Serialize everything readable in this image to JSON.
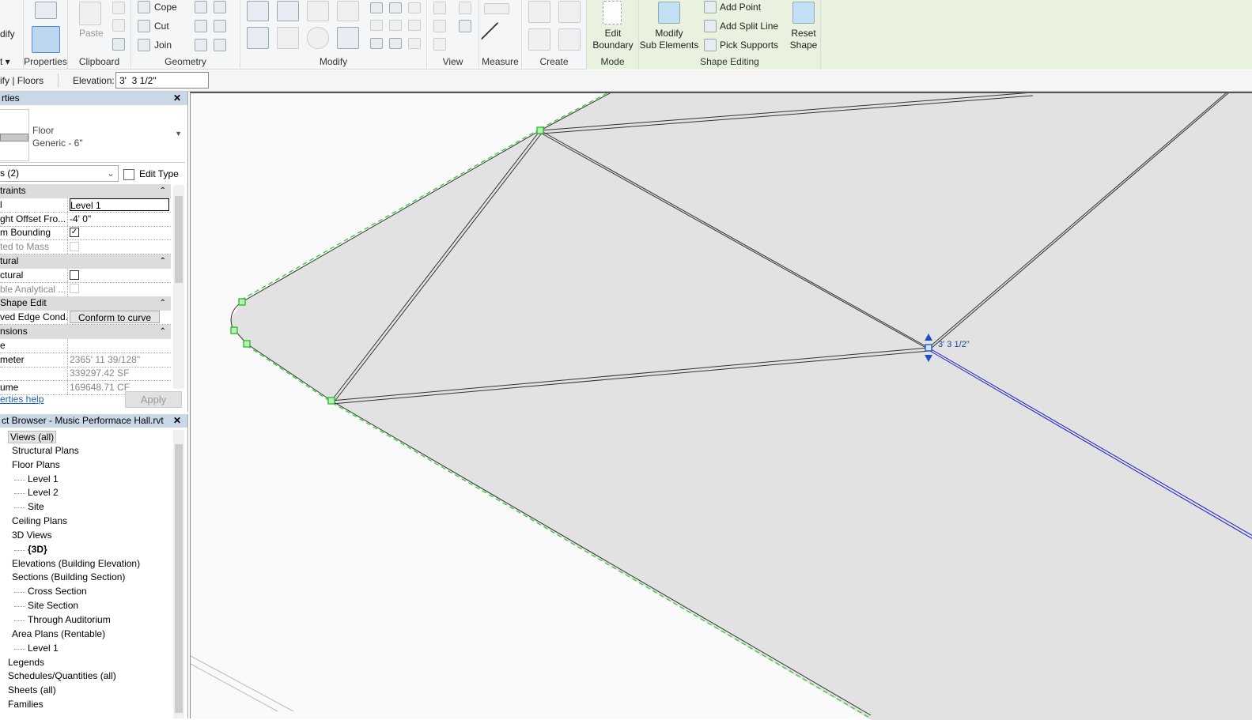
{
  "ribbon": {
    "panels": {
      "select": "t ▾",
      "properties": "Properties",
      "clipboard": "Clipboard",
      "geometry": "Geometry",
      "modify": "Modify",
      "view": "View",
      "measure": "Measure",
      "create": "Create",
      "mode": "Mode",
      "shape_editing": "Shape Editing"
    },
    "modify_tool": "dify",
    "paste": "Paste",
    "cope": "Cope",
    "cut": "Cut",
    "join": "Join",
    "edit_boundary": [
      "Edit",
      "Boundary"
    ],
    "modify_sub": [
      "Modify",
      "Sub Elements"
    ],
    "add_point": "Add Point",
    "add_split_line": "Add Split Line",
    "pick_supports": "Pick Supports",
    "reset_shape": [
      "Reset",
      "Shape"
    ]
  },
  "options_bar": {
    "context": "ify | Floors",
    "elevation_label": "Elevation:",
    "elevation_value": "3'  3 1/2\""
  },
  "properties": {
    "title": "rties",
    "type_family": "Floor",
    "type_name": "Generic - 6\"",
    "selector": "s (2)",
    "edit_type": "Edit Type",
    "rows": [
      {
        "k": "traints",
        "group": true
      },
      {
        "k": "l",
        "v": "Level 1",
        "input": true
      },
      {
        "k": "ght Offset Fro...",
        "v": "-4'  0\""
      },
      {
        "k": "m Bounding",
        "check": true,
        "checked": true
      },
      {
        "k": "ted to Mass",
        "check": true,
        "disabled": true
      },
      {
        "k": "tural",
        "group": true
      },
      {
        "k": "ctural",
        "check": true
      },
      {
        "k": "ble Analytical ...",
        "check": true,
        "disabled": true
      },
      {
        "k": "Shape Edit",
        "group": true
      },
      {
        "k": "ved Edge Cond...",
        "v": "Conform to curve",
        "button": true
      },
      {
        "k": "nsions",
        "group": true
      },
      {
        "k": "e",
        "v": ""
      },
      {
        "k": "meter",
        "v": "2365'  11 39/128\"",
        "disabled": true
      },
      {
        "k": "",
        "v": "339297.42 SF",
        "disabled": true
      },
      {
        "k": "ume",
        "v": "169648.71 CF",
        "disabled": true
      }
    ],
    "help": "erties help",
    "apply": "Apply"
  },
  "browser": {
    "title": "ct Browser - Music Performace Hall.rvt",
    "items": [
      {
        "label": "Views (all)",
        "level": 0,
        "selected": true
      },
      {
        "label": "Structural Plans",
        "level": 1
      },
      {
        "label": "Floor Plans",
        "level": 1
      },
      {
        "label": "Level 1",
        "level": 2
      },
      {
        "label": "Level 2",
        "level": 2
      },
      {
        "label": "Site",
        "level": 2
      },
      {
        "label": "Ceiling Plans",
        "level": 1
      },
      {
        "label": "3D Views",
        "level": 1
      },
      {
        "label": "{3D}",
        "level": 2,
        "bold": true
      },
      {
        "label": "Elevations (Building Elevation)",
        "level": 1
      },
      {
        "label": "Sections (Building Section)",
        "level": 1
      },
      {
        "label": "Cross Section",
        "level": 2
      },
      {
        "label": "Site Section",
        "level": 2
      },
      {
        "label": "Through Auditorium",
        "level": 2
      },
      {
        "label": "Area Plans (Rentable)",
        "level": 1
      },
      {
        "label": "Level 1",
        "level": 2
      },
      {
        "label": "Legends",
        "level": 0
      },
      {
        "label": "Schedules/Quantities (all)",
        "level": 0
      },
      {
        "label": "Sheets (all)",
        "level": 0
      },
      {
        "label": "Families",
        "level": 0
      }
    ]
  },
  "canvas": {
    "elevation_tag": "3' 3 1/2\"",
    "colors": {
      "boundary": "#33cc33",
      "selected": "#1a1acc",
      "floor": "#e2e2e2"
    }
  }
}
